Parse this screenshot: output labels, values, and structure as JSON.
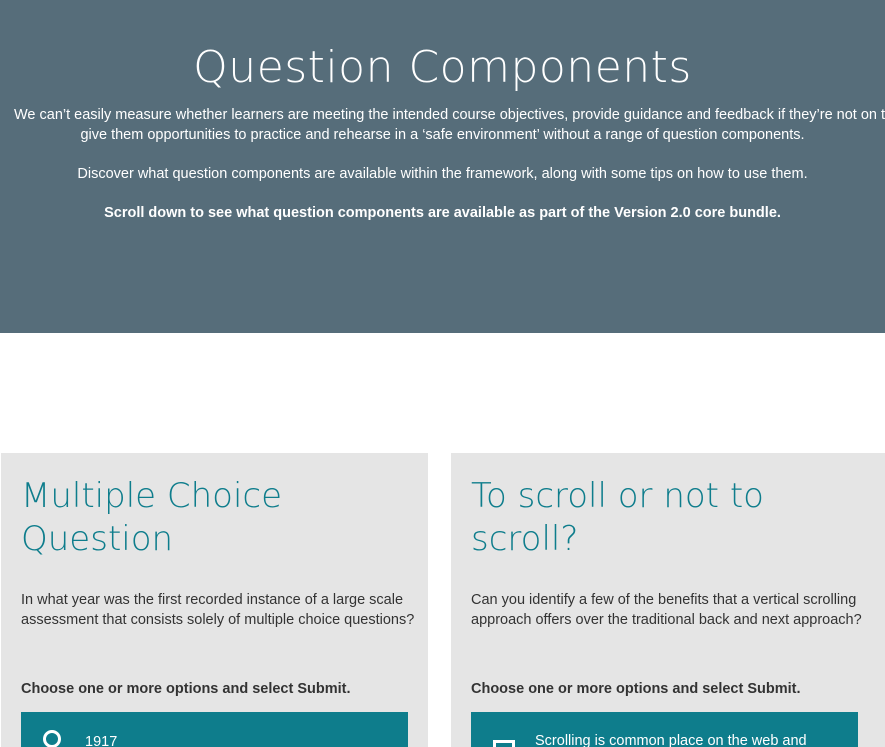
{
  "hero": {
    "title": "Question Components",
    "intro_line1": "We can’t easily measure whether learners are meeting the intended course objectives, provide guidance and feedback if they’re not on track, or",
    "intro_line2": "give them opportunities to practice and rehearse in a ‘safe environment’ without a range of question components.",
    "discover": "Discover what question components are available within the framework, along with some tips on how to use them.",
    "scroll_note": "Scroll down to see what question components are available as part of the Version 2.0 core bundle.",
    "background": "#566d7a"
  },
  "cards": [
    {
      "title": "Multiple Choice Question",
      "body": "In what year was the first recorded instance of a large scale assessment that consists solely of multiple choice questions?",
      "instruction": "Choose one or more options and select Submit.",
      "option_label": "1917",
      "option_icon": "radio-icon"
    },
    {
      "title": "To scroll or not to scroll?",
      "body": "Can you identify a few of the benefits that a vertical scrolling approach offers over the traditional back and next approach?",
      "instruction": "Choose one or more options and select Submit.",
      "option_label": "Scrolling is common place on the web and",
      "option_icon": "checkbox-icon"
    }
  ],
  "colors": {
    "accent": "#0e7d8c",
    "card_bg": "#e5e5e5",
    "text": "#333333"
  }
}
